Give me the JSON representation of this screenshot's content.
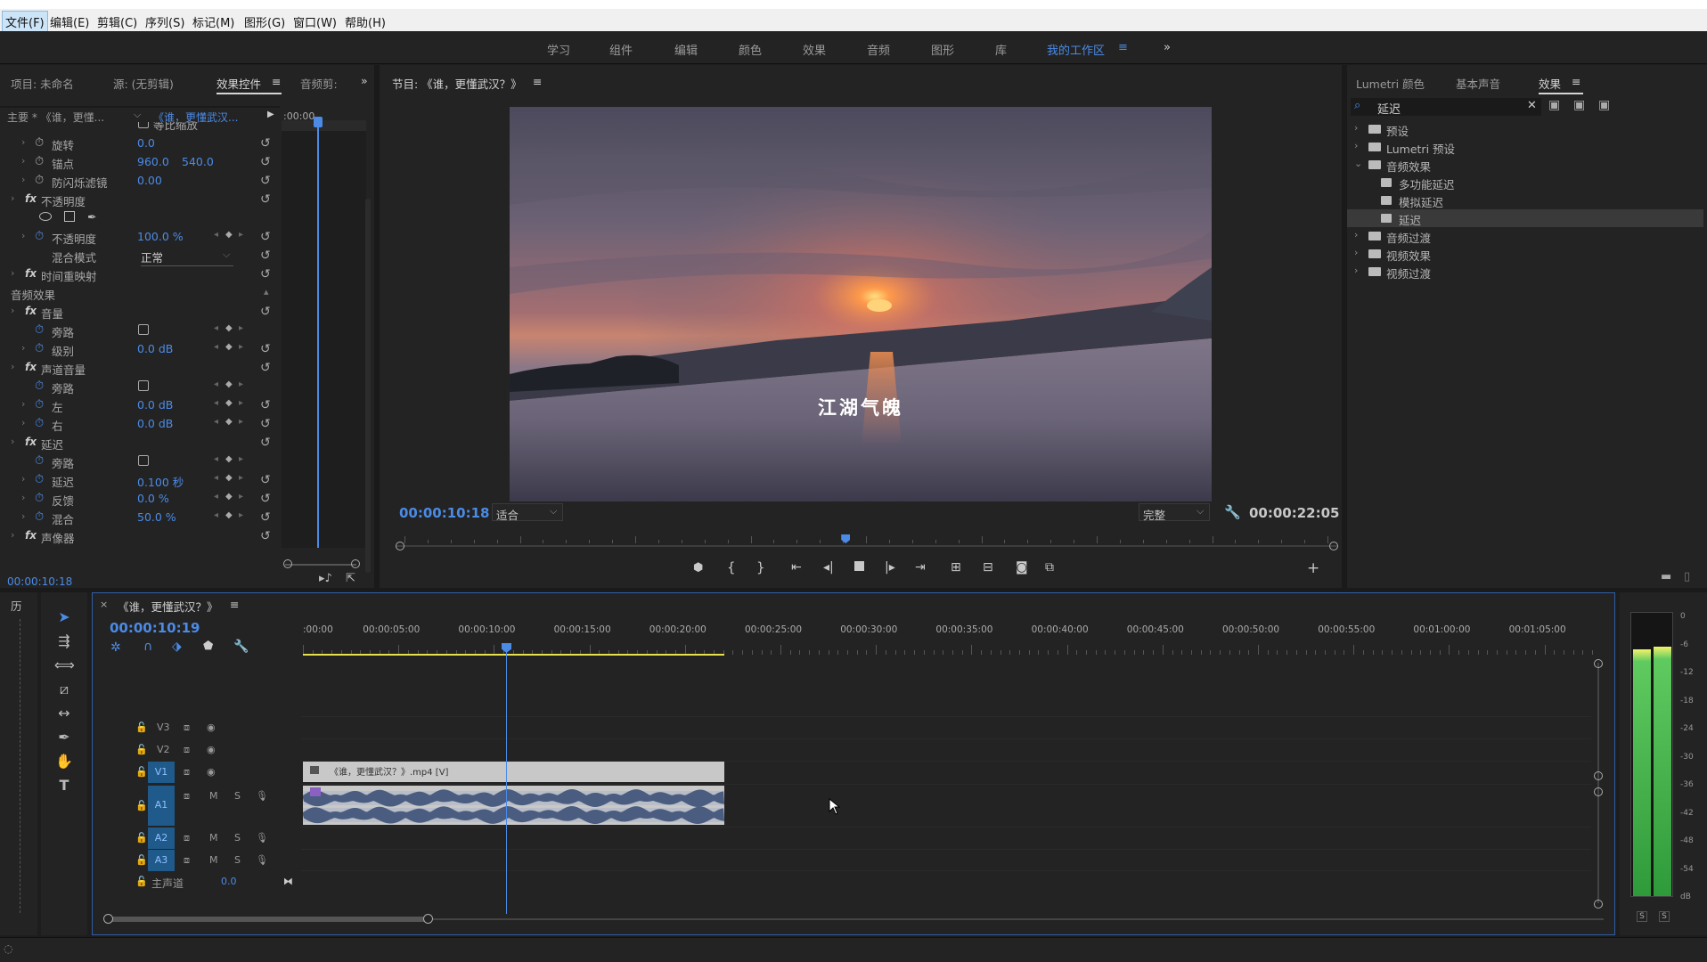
{
  "menu": {
    "items": [
      "文件(F)",
      "编辑(E)",
      "剪辑(C)",
      "序列(S)",
      "标记(M)",
      "图形(G)",
      "窗口(W)",
      "帮助(H)"
    ]
  },
  "workspaces": {
    "tabs": [
      "学习",
      "组件",
      "编辑",
      "颜色",
      "效果",
      "音频",
      "图形",
      "库",
      "我的工作区"
    ],
    "active": "我的工作区",
    "more": "»"
  },
  "left_panel": {
    "tabs": [
      "项目: 未命名",
      "源: (无剪辑)",
      "效果控件",
      "音频剪:"
    ],
    "master": "主要 * 《谁，更懂...",
    "clip": "《谁，更懂武汉...",
    "ruler_time": ":00:00",
    "partial_top": "等比缩放",
    "rows": [
      {
        "label": "旋转",
        "v1": "0.0"
      },
      {
        "label": "锚点",
        "v1": "960.0",
        "v2": "540.0"
      },
      {
        "label": "防闪烁滤镜",
        "v1": "0.00"
      },
      {
        "section": "不透明度"
      },
      {
        "label": "不透明度",
        "v1": "100.0 %"
      },
      {
        "label": "混合模式",
        "select": "正常"
      },
      {
        "section": "时间重映射"
      },
      {
        "group": "音频效果"
      },
      {
        "section": "音量"
      },
      {
        "label": "旁路",
        "checkbox": true
      },
      {
        "label": "级别",
        "v1": "0.0 dB"
      },
      {
        "section": "声道音量"
      },
      {
        "label": "旁路",
        "checkbox": true
      },
      {
        "label": "左",
        "v1": "0.0 dB"
      },
      {
        "label": "右",
        "v1": "0.0 dB"
      },
      {
        "section": "延迟"
      },
      {
        "label": "旁路",
        "checkbox": true
      },
      {
        "label": "延迟",
        "v1": "0.100 秒"
      },
      {
        "label": "反馈",
        "v1": "0.0 %"
      },
      {
        "label": "混合",
        "v1": "50.0 %"
      },
      {
        "section": "声像器"
      }
    ],
    "timecode": "00:00:10:18"
  },
  "program": {
    "tab": "节目: 《谁，更懂武汉？》",
    "subtitle": "江湖气魄",
    "timecode": "00:00:10:18",
    "fit": "适合",
    "quality": "完整",
    "duration": "00:00:22:05",
    "playhead_fraction": 0.478
  },
  "effects_panel": {
    "tabs": [
      "Lumetri 颜色",
      "基本声音",
      "效果"
    ],
    "search": "延迟",
    "tree": [
      {
        "label": "预设",
        "level": 0,
        "open": false
      },
      {
        "label": "Lumetri 预设",
        "level": 0,
        "open": false
      },
      {
        "label": "音频效果",
        "level": 0,
        "open": true
      },
      {
        "label": "多功能延迟",
        "level": 1
      },
      {
        "label": "模拟延迟",
        "level": 1
      },
      {
        "label": "延迟",
        "level": 1,
        "selected": true
      },
      {
        "label": "音频过渡",
        "level": 0,
        "open": false
      },
      {
        "label": "视频效果",
        "level": 0,
        "open": false
      },
      {
        "label": "视频过渡",
        "level": 0,
        "open": false
      }
    ]
  },
  "history": {
    "label": "历"
  },
  "timeline": {
    "tab": "《谁，更懂武汉？》",
    "timecode": "00:00:10:19",
    "ticks": [
      ":00:00",
      "00:00:05:00",
      "00:00:10:00",
      "00:00:15:00",
      "00:00:20:00",
      "00:00:25:00",
      "00:00:30:00",
      "00:00:35:00",
      "00:00:40:00",
      "00:00:45:00",
      "00:00:50:00",
      "00:00:55:00",
      "00:01:00:00",
      "00:01:05:00"
    ],
    "tracks": {
      "v3": "V3",
      "v2": "V2",
      "v1": "V1",
      "a1": "A1",
      "a2": "A2",
      "a3": "A3",
      "m": "M",
      "s": "S",
      "master": "主声道",
      "master_val": "0.0"
    },
    "clip_name": "《谁，更懂武汉？》.mp4 [V]"
  },
  "meter": {
    "labels": [
      "0",
      "-6",
      "-12",
      "-18",
      "-24",
      "-30",
      "-36",
      "-42",
      "-48",
      "-54",
      "dB"
    ],
    "solo": [
      "S",
      "S"
    ],
    "levels": [
      0.87,
      0.88
    ]
  },
  "colors": {
    "accent": "#4b8be6",
    "bg": "#232323",
    "yellow": "#e8e04a"
  }
}
